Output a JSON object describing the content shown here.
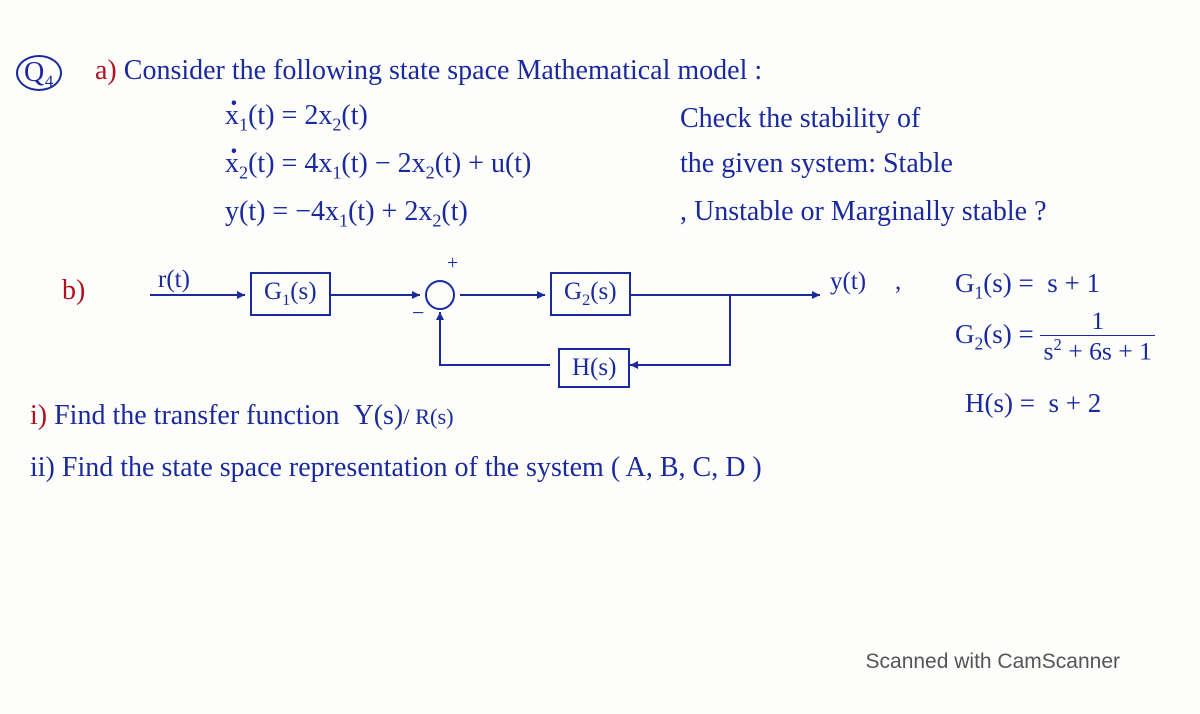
{
  "question_number": "Q₄",
  "part_a_label": "a)",
  "part_a_text": "Consider the following state space Mathematical model :",
  "equations": {
    "eq1": "ẋ₁(t) = 2x₂(t)",
    "eq2": "ẋ₂(t) = 4x₁(t) − 2x₂(t) + u(t)",
    "eq3": "y(t) = −4x₁(t) + 2x₂(t)"
  },
  "check_text": {
    "line1": "Check the stability of",
    "line2": "the given system: Stable",
    "line3": ", Unstable or Marginally stable ?"
  },
  "part_b_label": "b)",
  "diagram": {
    "input": "r(t)",
    "g1": "G₁(s)",
    "g2": "G₂(s)",
    "h": "H(s)",
    "output": "y(t)",
    "plus": "+",
    "minus": "−"
  },
  "transfer_functions": {
    "g1_lhs": "G₁(s) =",
    "g1_rhs": "s + 1",
    "g2_lhs": "G₂(s) =",
    "g2_num": "1",
    "g2_den": "s² + 6s + 1",
    "h_lhs": "H(s) =",
    "h_rhs": "s + 2"
  },
  "part_i": "i) Find the transfer function  Y(s)/R(s)",
  "part_ii": "ii) Find the state space representation of the system ( A, B, C, D )",
  "watermark": "Scanned with CamScanner"
}
